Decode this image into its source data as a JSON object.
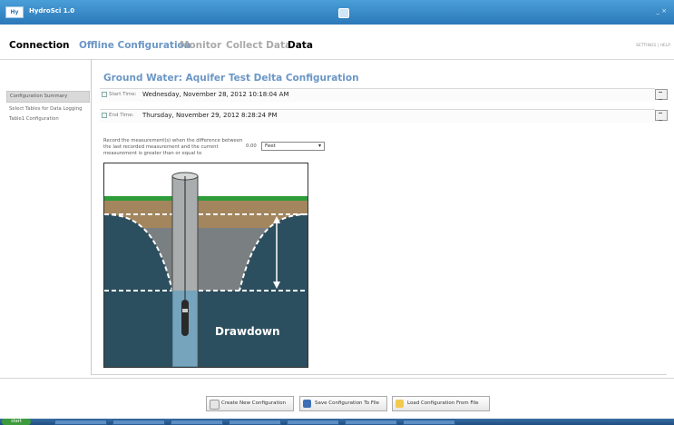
{
  "window": {
    "title": "HydroSci 1.0",
    "logo_text": "Hy",
    "controls": "_ ×"
  },
  "nav": {
    "tabs": [
      "Connection",
      "Offline Configuration",
      "Monitor",
      "Collect Data",
      "Data"
    ],
    "right_links": "SETTINGS | HELP",
    "colors": {
      "active": "#000000",
      "highlight": "#6b96c6",
      "inactive": "#a9a9a9"
    }
  },
  "sidebar": {
    "items": [
      {
        "label": "Configuration Summary"
      },
      {
        "label": "Select Tables for Data Logging"
      },
      {
        "label": "Table1 Configuration"
      }
    ]
  },
  "main": {
    "title": "Ground Water: Aquifer Test Delta Configuration",
    "start": {
      "label": "Start Time:",
      "value": "Wednesday, November 28, 2012 10:18:04 AM",
      "checked": true
    },
    "end": {
      "label": "End Time:",
      "value": "Thursday, November 29, 2012 8:28:24 PM",
      "checked": true
    },
    "record_text": "Record the measurement(s) when the difference between the last recorded measurement and the current measurement is greater than or equal to",
    "difference_value": "0.00",
    "unit_selected": "Feet",
    "illustration": {
      "label": "Drawdown"
    }
  },
  "footer": {
    "buttons": [
      {
        "label": "Create New Configuration",
        "icon": "new-config-icon"
      },
      {
        "label": "Save Configuration To File",
        "icon": "save-icon"
      },
      {
        "label": "Load Configuration From File",
        "icon": "open-folder-icon"
      }
    ]
  },
  "taskbar": {
    "start_label": "start"
  }
}
